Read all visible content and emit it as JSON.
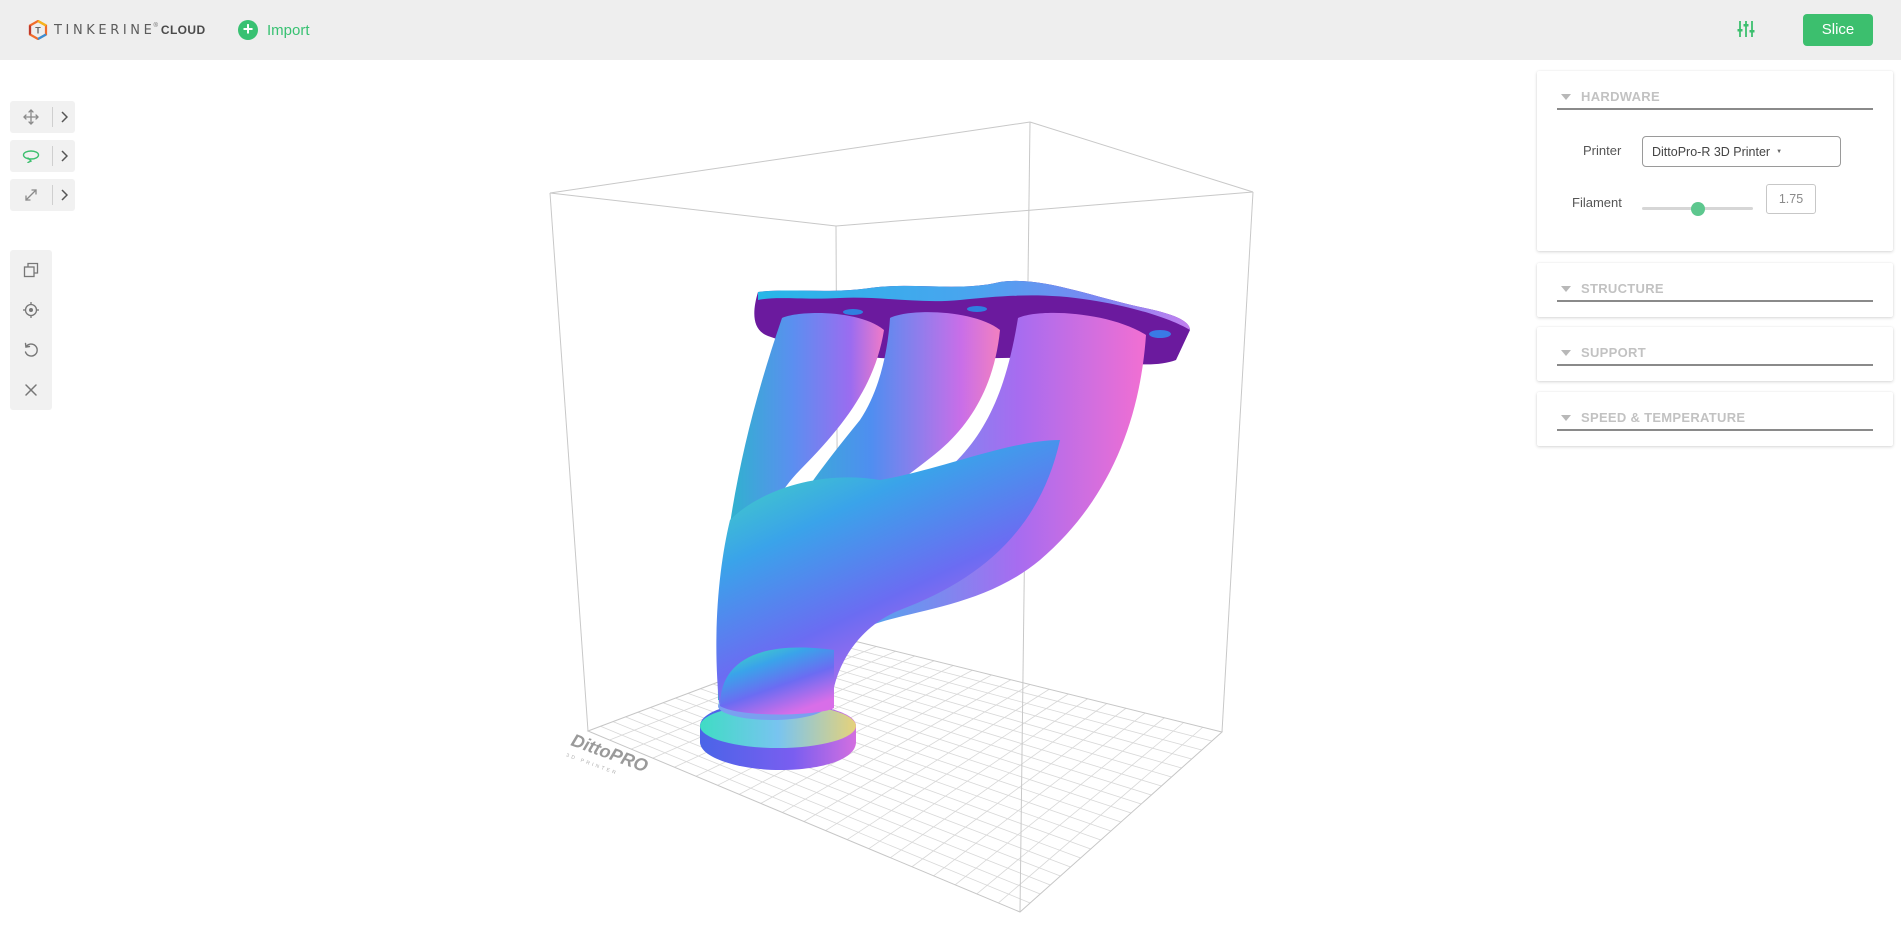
{
  "app": {
    "brand_word": "TINKERINE",
    "brand_reg": "®",
    "brand_suffix": "CLOUD"
  },
  "topbar": {
    "import_label": "Import",
    "slice_label": "Slice",
    "settings_icon": "sliders-icon"
  },
  "tools": {
    "move_icon": "move-arrows-icon",
    "rotate_icon": "rotate-icon",
    "scale_icon": "expand-arrows-icon",
    "active_tool": "rotate",
    "actions": [
      "duplicate-icon",
      "center-target-icon",
      "reset-undo-icon",
      "close-icon"
    ]
  },
  "panels": {
    "hardware": {
      "title": "HARDWARE",
      "printer_label": "Printer",
      "printer_value": "DittoPro-R 3D Printer",
      "filament_label": "Filament",
      "filament_value": "1.75",
      "filament_slider_fraction": 0.5
    },
    "structure": {
      "title": "STRUCTURE"
    },
    "support": {
      "title": "SUPPORT"
    },
    "speed": {
      "title": "SPEED & TEMPERATURE"
    }
  },
  "viewport": {
    "bed_brand": "DittoPRO",
    "bed_sub": "3D PRINTER"
  },
  "colors": {
    "accent": "#3cbf6e",
    "topbar_bg": "#eeeeee"
  }
}
